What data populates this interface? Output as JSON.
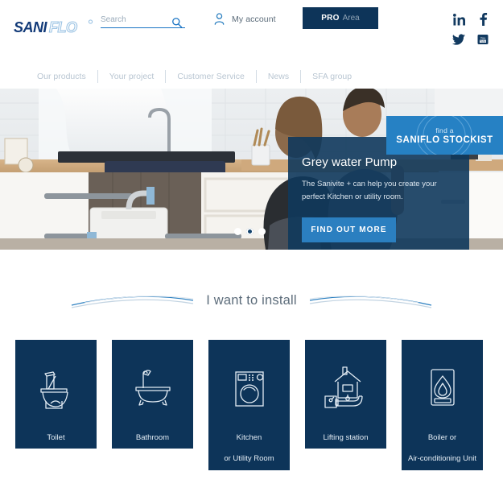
{
  "header": {
    "logo": {
      "part1": "SANI",
      "part2": "FLO"
    },
    "search": {
      "placeholder": "Search",
      "value": ""
    },
    "account_label": "My account",
    "pro_button": {
      "bold": "PRO",
      "light": "Area"
    },
    "social": [
      {
        "name": "linkedin-icon",
        "label": "LinkedIn"
      },
      {
        "name": "facebook-icon",
        "label": "Facebook"
      },
      {
        "name": "twitter-icon",
        "label": "Twitter"
      },
      {
        "name": "youtube-icon",
        "label": "YouTube"
      }
    ]
  },
  "nav": {
    "items": [
      {
        "label": "Our products"
      },
      {
        "label": "Your project"
      },
      {
        "label": "Customer Service"
      },
      {
        "label": "News"
      },
      {
        "label": "SFA group"
      }
    ],
    "stockist": {
      "line1": "find a",
      "line2": "SANIFLO STOCKIST"
    }
  },
  "hero": {
    "title": "Grey water Pump",
    "subtitle": "The Sanivite + can help you create your perfect Kitchen or utility room.",
    "button_label": "FIND OUT MORE",
    "slides": 3,
    "active_slide": 2
  },
  "section": {
    "title": "I want to install"
  },
  "cards": [
    {
      "icon": "toilet-icon",
      "line1": "Toilet",
      "line2": ""
    },
    {
      "icon": "bathtub-icon",
      "line1": "Bathroom",
      "line2": ""
    },
    {
      "icon": "washing-machine-icon",
      "line1": "Kitchen",
      "line2": "or Utility Room"
    },
    {
      "icon": "house-pump-icon",
      "line1": "Lifting station",
      "line2": ""
    },
    {
      "icon": "boiler-flame-icon",
      "line1": "Boiler or",
      "line2": "Air-conditioning Unit"
    }
  ],
  "colors": {
    "navy": "#0d3459",
    "brand_blue": "#2681c4",
    "hero_button": "#2b7fc0",
    "logo_dark": "#123a78",
    "logo_light": "#9dc4e4",
    "nav_text": "#b9c6d2"
  }
}
